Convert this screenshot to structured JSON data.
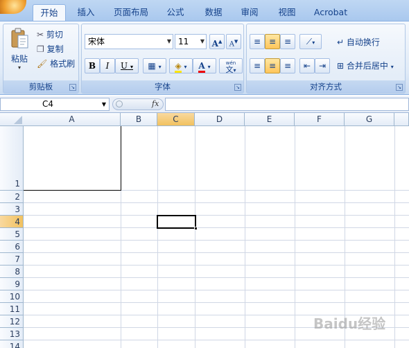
{
  "tabs": [
    "开始",
    "插入",
    "页面布局",
    "公式",
    "数据",
    "审阅",
    "视图",
    "Acrobat"
  ],
  "clipboard": {
    "paste": "粘贴",
    "cut": "剪切",
    "copy": "复制",
    "format_painter": "格式刷",
    "group": "剪贴板"
  },
  "font": {
    "name": "宋体",
    "size": "11",
    "grow": "A",
    "shrink": "A",
    "bold": "B",
    "italic": "I",
    "underline": "U",
    "font_color_glyph": "A",
    "phonetic": "文",
    "phonetic_top": "wén",
    "group": "字体"
  },
  "alignment": {
    "wrap_text": "自动换行",
    "merge_center": "合并后居中",
    "group": "对齐方式"
  },
  "formula_bar": {
    "name_box": "C4",
    "fx": "fx",
    "value": ""
  },
  "sheet": {
    "columns": [
      "A",
      "B",
      "C",
      "D",
      "E",
      "F",
      "G"
    ],
    "rows": [
      "1",
      "2",
      "3",
      "4",
      "5",
      "6",
      "7",
      "8",
      "9",
      "10",
      "11",
      "12",
      "13",
      "14"
    ],
    "selected_cell": "C4"
  },
  "watermark": "Baidu经验",
  "colors": {
    "accent": "#15428b",
    "selection": "#f1c15f",
    "gridline": "#d0d7e5"
  }
}
